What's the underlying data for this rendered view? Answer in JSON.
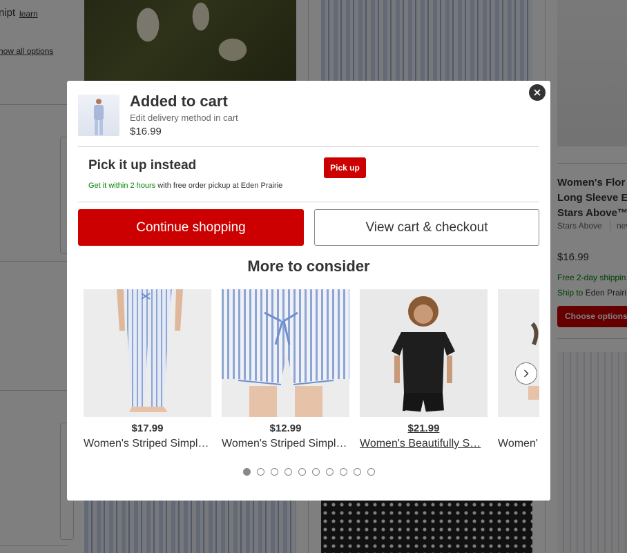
{
  "background": {
    "left_col": {
      "text_fragment": "nipt",
      "learn_link": "learn",
      "show_all_link": "how all options"
    },
    "product": {
      "title_lines": [
        "Women's Flor",
        "Long Sleeve E",
        "Stars Above™"
      ],
      "brand": "Stars Above",
      "brand_extra": "nev",
      "price": "$16.99",
      "shipping": "Free 2-day shippin",
      "ship_to_prefix": "Ship to ",
      "ship_to_store": "Eden Prairi",
      "choose_button": "Choose options"
    }
  },
  "modal": {
    "close_icon": "close-icon",
    "added": {
      "title": "Added to cart",
      "subtitle": "Edit delivery method in cart",
      "price": "$16.99"
    },
    "pickup": {
      "title": "Pick it up instead",
      "button": "Pick up",
      "highlight": "Get it within 2 hours",
      "rest": " with free order pickup at Eden Prairie"
    },
    "continue_button": "Continue shopping",
    "cart_button": "View cart & checkout",
    "more_title": "More to consider",
    "recommendations": [
      {
        "price": "$17.99",
        "name": "Women's Striped Simpl…"
      },
      {
        "price": "$12.99",
        "name": "Women's Striped Simpl…"
      },
      {
        "price": "$21.99",
        "name": "Women's Beautifully S…"
      },
      {
        "price": "",
        "name": "Women'"
      }
    ],
    "next_icon": "chevron-right-icon",
    "carousel_pages": 10,
    "active_page": 1
  },
  "colors": {
    "brand_red": "#cc0000",
    "green": "#008300",
    "overlay": "rgba(0,0,0,0.5)"
  }
}
